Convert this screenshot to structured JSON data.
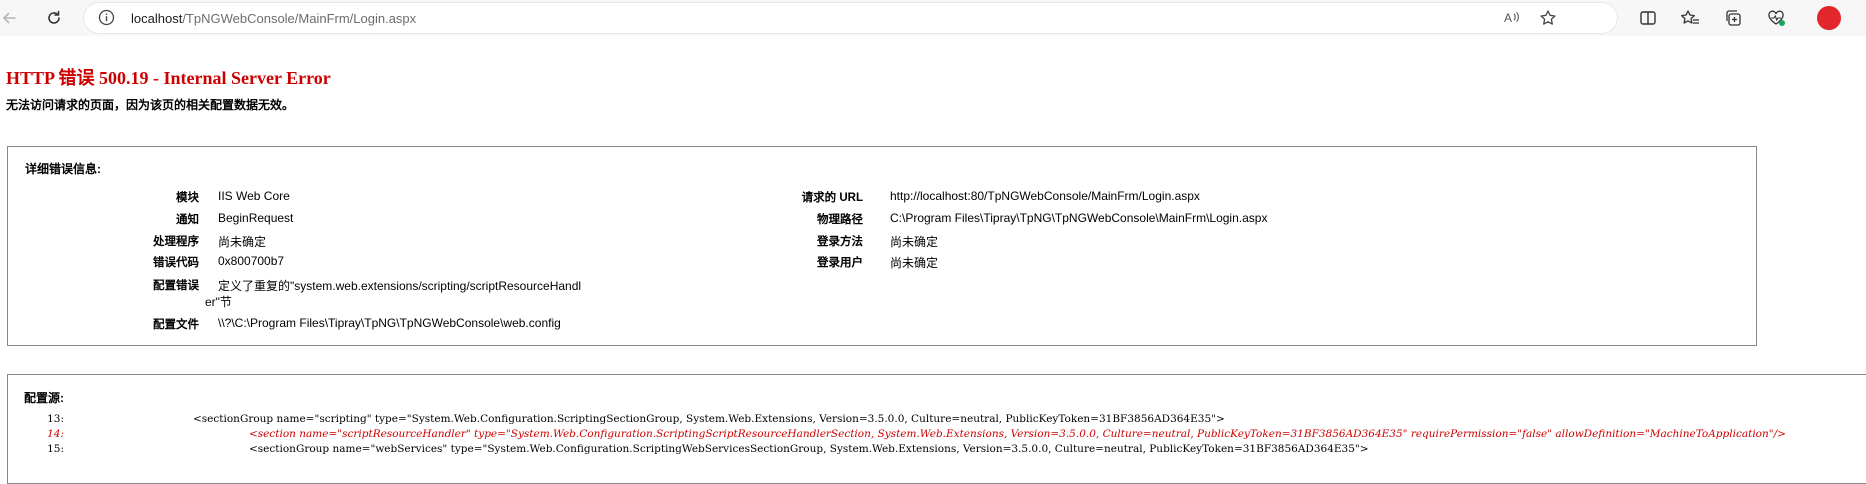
{
  "browser": {
    "url_host": "localhost",
    "url_path": "/TpNGWebConsole/MainFrm/Login.aspx"
  },
  "error": {
    "title": "HTTP 错误 500.19 - Internal Server Error",
    "subtitle": "无法访问请求的页面，因为该页的相关配置数据无效。"
  },
  "details": {
    "heading": "详细错误信息:",
    "left": [
      {
        "label": "模块",
        "value": "IIS Web Core"
      },
      {
        "label": "通知",
        "value": "BeginRequest"
      },
      {
        "label": "处理程序",
        "value": "尚未确定"
      },
      {
        "label": "错误代码",
        "value": "0x800700b7"
      },
      {
        "label": "配置错误",
        "value_line1": "定义了重复的\"system.web.extensions/scripting/scriptResourceHandl",
        "value_line2": "er\"节"
      },
      {
        "label": "配置文件",
        "value": "\\\\?\\C:\\Program Files\\Tipray\\TpNG\\TpNGWebConsole\\web.config"
      }
    ],
    "right": [
      {
        "label": "请求的 URL",
        "value": "http://localhost:80/TpNGWebConsole/MainFrm/Login.aspx"
      },
      {
        "label": "物理路径",
        "value": "C:\\Program Files\\Tipray\\TpNG\\TpNGWebConsole\\MainFrm\\Login.aspx"
      },
      {
        "label": "登录方法",
        "value": "尚未确定"
      },
      {
        "label": "登录用户",
        "value": "尚未确定"
      }
    ]
  },
  "config_source": {
    "heading": "配置源:",
    "lines": [
      {
        "no": "13:",
        "text": "<sectionGroup name=\"scripting\" type=\"System.Web.Configuration.ScriptingSectionGroup, System.Web.Extensions, Version=3.5.0.0, Culture=neutral, PublicKeyToken=31BF3856AD364E35\">"
      },
      {
        "no": "14:",
        "text": "<section name=\"scriptResourceHandler\" type=\"System.Web.Configuration.ScriptingScriptResourceHandlerSection, System.Web.Extensions, Version=3.5.0.0, Culture=neutral, PublicKeyToken=31BF3856AD364E35\" requirePermission=\"false\" allowDefinition=\"MachineToApplication\"/>"
      },
      {
        "no": "15:",
        "text": "<sectionGroup name=\"webServices\" type=\"System.Web.Configuration.ScriptingWebServicesSectionGroup, System.Web.Extensions, Version=3.5.0.0, Culture=neutral, PublicKeyToken=31BF3856AD364E35\">"
      }
    ]
  },
  "colors": {
    "error_red": "#cc0000",
    "chrome_bg": "#f7f7f7"
  },
  "icons": {
    "back": "back-arrow-icon",
    "refresh": "refresh-icon",
    "site_info": "info-icon",
    "read_aloud": "read-aloud-icon",
    "favorite": "star-icon",
    "split": "split-screen-icon",
    "favorites": "favorites-icon",
    "collections": "collections-icon",
    "health": "browser-essentials-icon",
    "profile": "profile-icon"
  }
}
